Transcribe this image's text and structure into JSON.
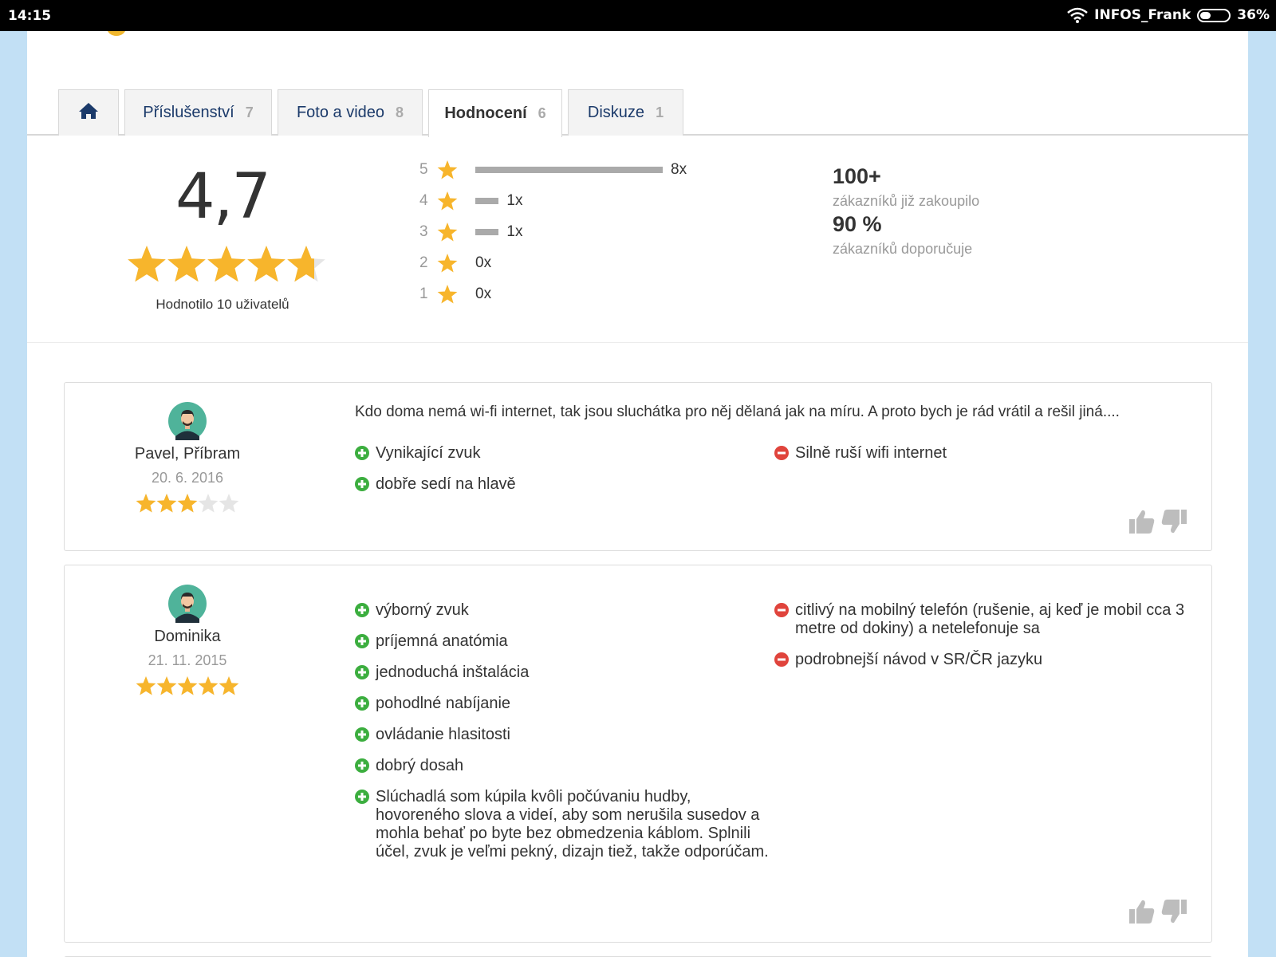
{
  "status_bar": {
    "time": "14:15",
    "network": "INFOS_Frank",
    "battery": "36%",
    "battery_level": 0.36
  },
  "tabs": [
    {
      "label": "",
      "icon": "home-icon",
      "count": ""
    },
    {
      "label": "Příslušenství",
      "count": "7"
    },
    {
      "label": "Foto a video",
      "count": "8"
    },
    {
      "label": "Hodnocení",
      "count": "6",
      "active": true
    },
    {
      "label": "Diskuze",
      "count": "1"
    }
  ],
  "summary": {
    "average": "4,7",
    "average_value": 4.7,
    "rated_by": "Hodnotilo 10 uživatelů",
    "distribution": [
      {
        "stars": "5",
        "count": "8x",
        "value": 8
      },
      {
        "stars": "4",
        "count": "1x",
        "value": 1
      },
      {
        "stars": "3",
        "count": "1x",
        "value": 1
      },
      {
        "stars": "2",
        "count": "0x",
        "value": 0
      },
      {
        "stars": "1",
        "count": "0x",
        "value": 0
      }
    ],
    "customers_bought_value": "100+",
    "customers_bought_label": "zákazníků již zakoupilo",
    "recommend_value": "90 %",
    "recommend_label": "zákazníků doporučuje"
  },
  "reviews": [
    {
      "name": "Pavel, Příbram",
      "date": "20. 6. 2016",
      "rating": 3,
      "text": "Kdo doma nemá wi-fi internet, tak jsou sluchátka pro něj dělaná jak na míru. A proto bych je rád vrátil a rešil jiná....",
      "pros": [
        "Vynikající zvuk",
        "dobře sedí na hlavě"
      ],
      "cons": [
        "Silně ruší wifi internet"
      ]
    },
    {
      "name": "Dominika",
      "date": "21. 11. 2015",
      "rating": 5,
      "text": "",
      "pros": [
        "výborný zvuk",
        "príjemná anatómia",
        "jednoduchá inštalácia",
        "pohodlné nabíjanie",
        "ovládanie hlasitosti",
        "dobrý dosah",
        "Slúchadlá som kúpila kvôli počúvaniu hudby, hovoreného slova a videí, aby som nerušila susedov a mohla behať po byte bez obmedzenia káblom. Splnili účel, zvuk je veľmi pekný, dizajn tiež, takže odporúčam."
      ],
      "cons": [
        "citlivý na mobilný telefón (rušenie, aj keď je mobil cca 3 metre od dokiny) a netelefonuje sa",
        "podrobnejší návod v SR/ČR jazyku"
      ]
    }
  ],
  "colors": {
    "star": "#f7b52c",
    "plus": "#3cae3f",
    "minus": "#e0443c",
    "link": "#1b3a6a"
  }
}
